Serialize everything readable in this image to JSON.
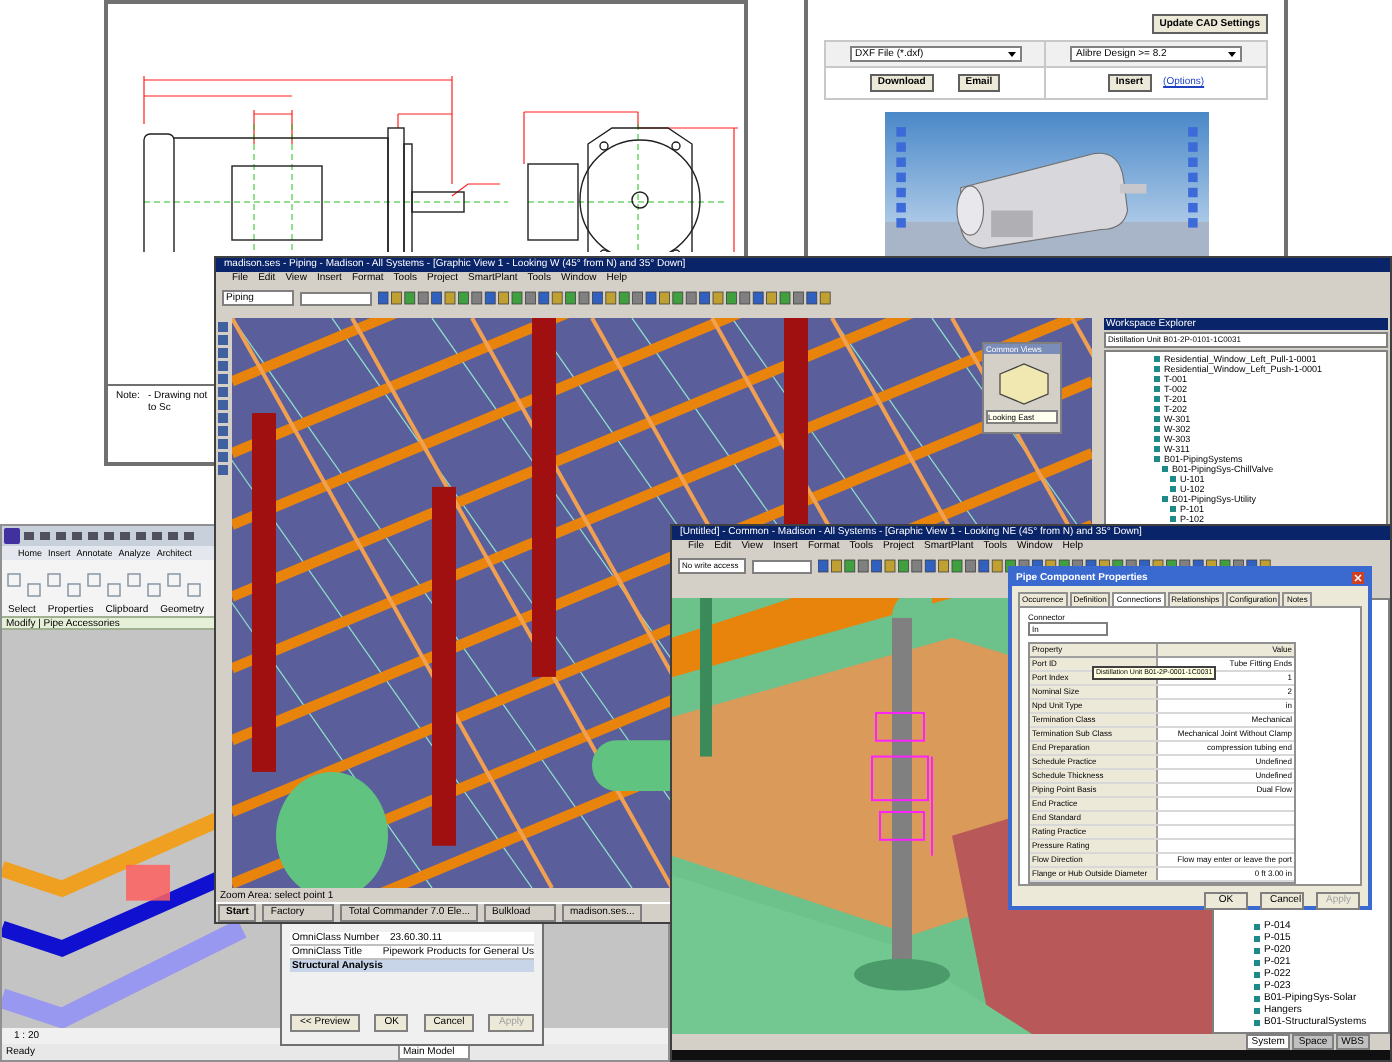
{
  "drawing_sheet": {
    "note_label": "Note:",
    "note_text": "- Drawing not to Sc"
  },
  "cad_panel": {
    "update_button": "Update CAD Settings",
    "format_select": "DXF File (*.dxf)",
    "version_select": "Alibre Design >= 8.2",
    "buttons": [
      "Download",
      "Email"
    ],
    "insert_button": "Insert",
    "options_link": "(Options)"
  },
  "main_window": {
    "title": "madison.ses - Piping - Madison - All Systems - [Graphic View 1 - Looking W (45° from N) and 35° Down]",
    "menu": [
      "File",
      "Edit",
      "View",
      "Insert",
      "Format",
      "Tools",
      "Project",
      "SmartPlant",
      "Tools",
      "Window",
      "Help"
    ],
    "task_select": "Piping",
    "common_views": {
      "title": "Common Views",
      "value": "Looking East"
    },
    "explorer": {
      "title": "Workspace Explorer",
      "filter": "Distillation Unit B01-2P-0101-1C0031",
      "tree": [
        {
          "label": "Residential_Window_Left_Pull-1-0001"
        },
        {
          "label": "Residential_Window_Left_Push-1-0001"
        },
        {
          "label": "T-001"
        },
        {
          "label": "T-002"
        },
        {
          "label": "T-201"
        },
        {
          "label": "T-202"
        },
        {
          "label": "W-301"
        },
        {
          "label": "W-302"
        },
        {
          "label": "W-303"
        },
        {
          "label": "W-311"
        },
        {
          "label": "B01-PipingSystems",
          "children": [
            {
              "label": "B01-PipingSys-ChillValve",
              "children": [
                {
                  "label": "U-101"
                },
                {
                  "label": "U-102"
                }
              ]
            },
            {
              "label": "B01-PipingSys-Utility",
              "children": [
                {
                  "label": "P-101"
                },
                {
                  "label": "P-102"
                }
              ]
            }
          ]
        }
      ]
    },
    "status": "Zoom Area: select point 1",
    "taskbar": [
      "Start",
      "Factory",
      "Total Commander 7.0 Ele...",
      "Bulkload",
      "madison.ses..."
    ]
  },
  "revit_window": {
    "tabs": [
      "Home",
      "Insert",
      "Annotate",
      "Analyze",
      "Architect"
    ],
    "groups": [
      "Select",
      "Properties",
      "Clipboard",
      "Geometry"
    ],
    "context": "Modify | Pipe Accessories",
    "scale": "1 : 20",
    "status": "Ready",
    "model_select": "Main Model"
  },
  "type_dialog": {
    "rows": [
      {
        "name": "OmniClass Number",
        "value": "23.60.30.11"
      },
      {
        "name": "OmniClass Title",
        "value": "Pipework Products for General Us"
      }
    ],
    "section": "Structural Analysis",
    "buttons": [
      {
        "label": "<< Preview",
        "disabled": false
      },
      {
        "label": "OK",
        "disabled": false
      },
      {
        "label": "Cancel",
        "disabled": false
      },
      {
        "label": "Apply",
        "disabled": true
      }
    ]
  },
  "second_window": {
    "title": "[Untitled] - Common - Madison - All Systems - [Graphic View 1 - Looking NE (45° from N) and 35° Down]",
    "menu": [
      "File",
      "Edit",
      "View",
      "Insert",
      "Format",
      "Tools",
      "Project",
      "SmartPlant",
      "Tools",
      "Window",
      "Help"
    ],
    "access_select": "No write access",
    "tree": [
      {
        "label": "P-014"
      },
      {
        "label": "P-015"
      },
      {
        "label": "P-020"
      },
      {
        "label": "P-021"
      },
      {
        "label": "P-022"
      },
      {
        "label": "P-023"
      },
      {
        "label": "B01-PipingSys-Solar"
      },
      {
        "label": "Hangers"
      },
      {
        "label": "B01-StructuralSystems"
      }
    ],
    "bottom_tabs": [
      {
        "label": "System",
        "selected": true
      },
      {
        "label": "Space",
        "selected": false
      },
      {
        "label": "WBS",
        "selected": false
      }
    ]
  },
  "properties_dialog": {
    "title": "Pipe Component Properties",
    "tabs": [
      {
        "label": "Occurrence",
        "selected": false
      },
      {
        "label": "Definition",
        "selected": false
      },
      {
        "label": "Connections",
        "selected": true
      },
      {
        "label": "Relationships",
        "selected": false
      },
      {
        "label": "Configuration",
        "selected": false
      },
      {
        "label": "Notes",
        "selected": false
      }
    ],
    "connector_label": "Connector",
    "connector": "In",
    "columns": [
      "Property",
      "Value"
    ],
    "rows": [
      {
        "property": "Port ID",
        "value": "Tube Fitting Ends"
      },
      {
        "property": "Port Index",
        "value": "1"
      },
      {
        "property": "Nominal Size",
        "value": "2"
      },
      {
        "property": "Npd Unit Type",
        "value": "in"
      },
      {
        "property": "Termination Class",
        "value": "Mechanical"
      },
      {
        "property": "Termination Sub Class",
        "value": "Mechanical Joint Without Clamp"
      },
      {
        "property": "End Preparation",
        "value": "compression tubing end"
      },
      {
        "property": "Schedule Practice",
        "value": "Undefined"
      },
      {
        "property": "Schedule Thickness",
        "value": "Undefined"
      },
      {
        "property": "Piping Point Basis",
        "value": "Dual Flow"
      },
      {
        "property": "End Practice",
        "value": ""
      },
      {
        "property": "End Standard",
        "value": ""
      },
      {
        "property": "Rating Practice",
        "value": ""
      },
      {
        "property": "Pressure Rating",
        "value": ""
      },
      {
        "property": "Flow Direction",
        "value": "Flow may enter or leave the port"
      },
      {
        "property": "Flange or Hub Outside Diameter",
        "value": "0 ft 3.00 in"
      }
    ],
    "tooltip": "Distillation Unit B01-2P-0001-1C0031",
    "buttons": [
      {
        "label": "OK",
        "disabled": false
      },
      {
        "label": "Cancel",
        "disabled": false
      },
      {
        "label": "Apply",
        "disabled": true
      }
    ]
  }
}
